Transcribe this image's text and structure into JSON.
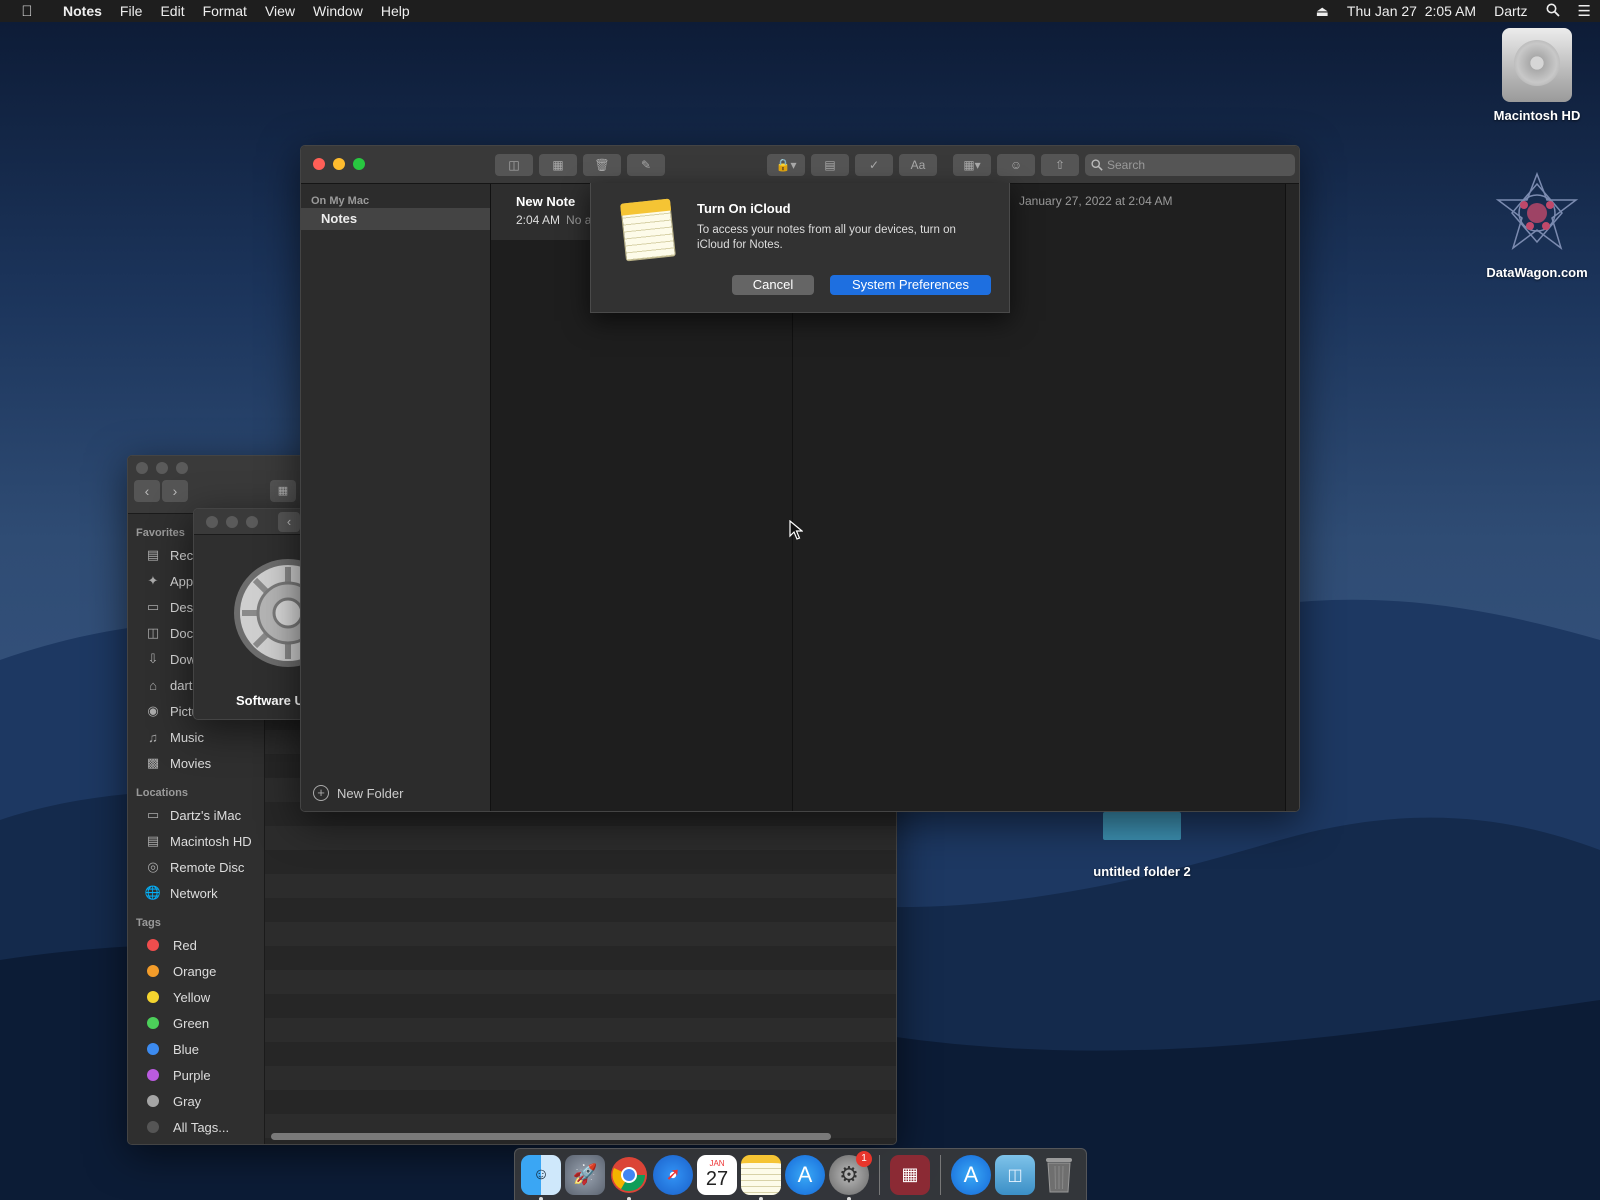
{
  "menubar": {
    "app_name": "Notes",
    "menus": [
      "File",
      "Edit",
      "Format",
      "View",
      "Window",
      "Help"
    ],
    "clock": "Thu Jan 27  2:05 AM",
    "user": "Dartz"
  },
  "desktop": {
    "icons": [
      {
        "label": "Macintosh HD"
      },
      {
        "label": "DataWagon.com"
      },
      {
        "label": "untitled folder 2"
      }
    ]
  },
  "finder": {
    "sidebar": {
      "favorites_header": "Favorites",
      "favorites": [
        {
          "label": "Recents",
          "icon": "recents-icon"
        },
        {
          "label": "Applications",
          "icon": "applications-icon"
        },
        {
          "label": "Desktop",
          "icon": "desktop-icon"
        },
        {
          "label": "Documents",
          "icon": "documents-icon"
        },
        {
          "label": "Downloads",
          "icon": "downloads-icon"
        },
        {
          "label": "dartz",
          "icon": "home-icon"
        },
        {
          "label": "Pictures",
          "icon": "pictures-icon"
        },
        {
          "label": "Music",
          "icon": "music-icon"
        },
        {
          "label": "Movies",
          "icon": "movies-icon"
        }
      ],
      "locations_header": "Locations",
      "locations": [
        {
          "label": "Dartz's iMac",
          "icon": "imac-icon"
        },
        {
          "label": "Macintosh HD",
          "icon": "disk-icon"
        },
        {
          "label": "Remote Disc",
          "icon": "disc-icon"
        },
        {
          "label": "Network",
          "icon": "network-icon"
        }
      ],
      "tags_header": "Tags",
      "tags": [
        {
          "label": "Red",
          "color": "#ef4d4d"
        },
        {
          "label": "Orange",
          "color": "#f39c2a"
        },
        {
          "label": "Yellow",
          "color": "#f5d52f"
        },
        {
          "label": "Green",
          "color": "#4cd05a"
        },
        {
          "label": "Blue",
          "color": "#3c8bf0"
        },
        {
          "label": "Purple",
          "color": "#bb5be0"
        },
        {
          "label": "Gray",
          "color": "#a5a5a5"
        },
        {
          "label": "All Tags...",
          "color": "#555555"
        }
      ]
    }
  },
  "software_update": {
    "label": "Software Update"
  },
  "notes_window": {
    "search_placeholder": "Search",
    "folders": {
      "header": "On My Mac",
      "selected": "Notes",
      "new_folder": "New Folder"
    },
    "note": {
      "title": "New Note",
      "time": "2:04 AM",
      "preview": "No additional text"
    },
    "editor_date": "January 27, 2022 at 2:04 AM"
  },
  "dialog": {
    "title": "Turn On iCloud",
    "message": "To access your notes from all your devices, turn on iCloud for Notes.",
    "cancel": "Cancel",
    "confirm": "System Preferences"
  },
  "dock": {
    "calendar_day": "27",
    "calendar_month": "JAN",
    "prefs_badge": "1"
  },
  "colors": {
    "accent": "#1e6fe0",
    "traffic_red": "#ff5f57",
    "traffic_yellow": "#febc2e",
    "traffic_green": "#28c840"
  }
}
